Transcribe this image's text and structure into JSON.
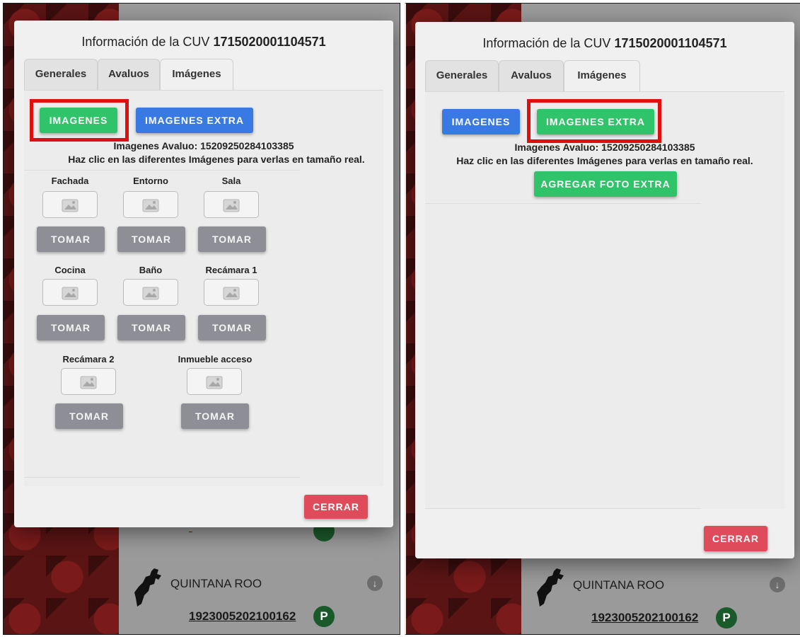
{
  "modal": {
    "title_prefix": "Información de la CUV",
    "cuv": "1715020001104571",
    "tabs": [
      "Generales",
      "Avaluos",
      "Imágenes"
    ],
    "buttons": {
      "imagenes": "IMAGENES",
      "imagenes_extra": "IMAGENES EXTRA",
      "agregar_foto_extra": "AGREGAR FOTO EXTRA",
      "cerrar": "CERRAR"
    },
    "avaluo_line": "Imagenes Avaluo: 15209250284103385",
    "instructions": "Haz clic en las diferentes Imágenes para verlas en tamaño real.",
    "image_slots": [
      {
        "label": "Fachada",
        "button": "TOMAR"
      },
      {
        "label": "Entorno",
        "button": "TOMAR"
      },
      {
        "label": "Sala",
        "button": "TOMAR"
      },
      {
        "label": "Cocina",
        "button": "TOMAR"
      },
      {
        "label": "Baño",
        "button": "TOMAR"
      },
      {
        "label": "Recámara 1",
        "button": "TOMAR"
      },
      {
        "label": "Recámara 2",
        "button": "TOMAR"
      },
      {
        "label": "Inmueble acceso",
        "button": "TOMAR"
      }
    ]
  },
  "background": {
    "state": "QUINTANA ROO",
    "cuv_link": "1923005202100162",
    "badge": "P"
  },
  "colors": {
    "green": "#2fc46a",
    "blue": "#3979e3",
    "gray": "#8e8f96",
    "red": "#e04b5c",
    "highlight": "#e00f0f"
  },
  "icons": {
    "image_placeholder": "image-placeholder-icon",
    "state_map": "quintana-roo-map-icon",
    "arrow": "arrow-down-icon"
  }
}
